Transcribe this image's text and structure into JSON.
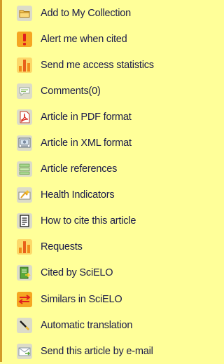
{
  "services": {
    "items": [
      {
        "id": "add-collection",
        "label": "Add to My Collection",
        "icon": "folder-icon"
      },
      {
        "id": "alert-cited",
        "label": "Alert me when cited",
        "icon": "exclamation-icon"
      },
      {
        "id": "access-statistics",
        "label": "Send me access statistics",
        "icon": "bar-chart-icon"
      },
      {
        "id": "comments",
        "label": "Comments(0)",
        "icon": "speech-bubble-icon"
      },
      {
        "id": "pdf",
        "label": "Article in PDF format",
        "icon": "pdf-icon"
      },
      {
        "id": "xml",
        "label": "Article in XML format",
        "icon": "xml-icon"
      },
      {
        "id": "references",
        "label": "Article references",
        "icon": "references-icon"
      },
      {
        "id": "health-indicators",
        "label": "Health Indicators",
        "icon": "health-indicators-icon"
      },
      {
        "id": "how-to-cite",
        "label": "How to cite this article",
        "icon": "document-icon"
      },
      {
        "id": "requests",
        "label": "Requests",
        "icon": "bar-chart-icon"
      },
      {
        "id": "cited-by",
        "label": "Cited by SciELO",
        "icon": "cited-document-icon"
      },
      {
        "id": "similars",
        "label": "Similars in SciELO",
        "icon": "arrows-icon"
      },
      {
        "id": "translation",
        "label": "Automatic translation",
        "icon": "wand-icon"
      },
      {
        "id": "send-email",
        "label": "Send this article by e-mail",
        "icon": "envelope-icon"
      }
    ]
  },
  "colors": {
    "background": "#ffff99",
    "border": "#d39a2a",
    "text": "#1a1a4a",
    "icon_orange": "#f08c1a",
    "icon_red": "#e01e1e",
    "icon_gray": "#d9d9c8"
  }
}
